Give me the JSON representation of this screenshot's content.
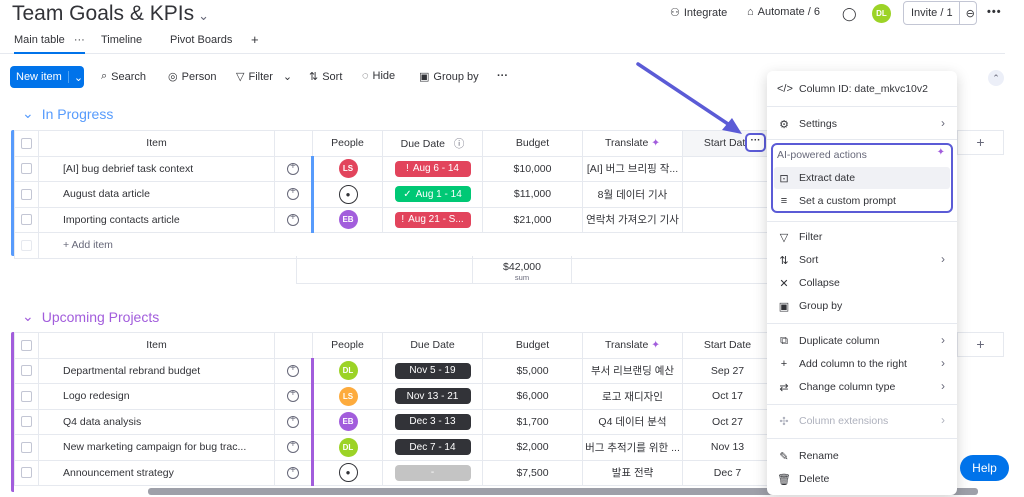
{
  "board": {
    "title": "Team Goals & KPIs"
  },
  "tabs": [
    "Main table",
    "Timeline",
    "Pivot Boards"
  ],
  "header": {
    "integrate": "Integrate",
    "automate": "Automate / 6",
    "user_initials": "DL",
    "invite": "Invite / 1"
  },
  "toolbar": {
    "new_item": "New item",
    "search": "Search",
    "person": "Person",
    "filter": "Filter",
    "sort": "Sort",
    "hide": "Hide",
    "group_by": "Group by"
  },
  "columns": {
    "item": "Item",
    "people": "People",
    "due_date": "Due Date",
    "budget": "Budget",
    "translate": "Translate",
    "start_date": "Start Date"
  },
  "groups": [
    {
      "title": "In Progress",
      "color": "#579bfc",
      "rows": [
        {
          "name": "[AI] bug debrief task context",
          "person": "LS",
          "person_color": "#e2445c",
          "due": "Aug 6 - 14",
          "due_color": "#e2445c",
          "due_icon": "!",
          "budget": "$10,000",
          "translate": "[AI] 버그 브리핑 작...",
          "start": ""
        },
        {
          "name": "August data article",
          "person": "",
          "person_color": "#323338",
          "due": "Aug 1 - 14",
          "due_color": "#00c875",
          "due_icon": "✓",
          "budget": "$11,000",
          "translate": "8월 데이터 기사",
          "start": ""
        },
        {
          "name": "Importing contacts article",
          "person": "EB",
          "person_color": "#a25ddc",
          "due": "Aug 21 - S...",
          "due_color": "#e2445c",
          "due_icon": "!",
          "budget": "$21,000",
          "translate": "연락처 가져오기 기사",
          "start": ""
        }
      ],
      "add_item": "+ Add item",
      "sum_value": "$42,000",
      "sum_label": "sum"
    },
    {
      "title": "Upcoming Projects",
      "color": "#a25ddc",
      "rows": [
        {
          "name": "Departmental rebrand budget",
          "person": "DL",
          "person_color": "#9cd326",
          "due": "Nov 5 - 19",
          "due_color": "#323338",
          "due_icon": "",
          "budget": "$5,000",
          "translate": "부서 리브랜딩 예산",
          "start": "Sep 27"
        },
        {
          "name": "Logo redesign",
          "person": "LS",
          "person_color": "#fdab3d",
          "due": "Nov 13 - 21",
          "due_color": "#323338",
          "due_icon": "",
          "budget": "$6,000",
          "translate": "로고 재디자인",
          "start": "Oct 17"
        },
        {
          "name": "Q4 data analysis",
          "person": "EB",
          "person_color": "#a25ddc",
          "due": "Dec 3 - 13",
          "due_color": "#323338",
          "due_icon": "",
          "budget": "$1,700",
          "translate": "Q4 데이터 분석",
          "start": "Oct 27"
        },
        {
          "name": "New marketing campaign for bug trac...",
          "person": "DL",
          "person_color": "#9cd326",
          "due": "Dec 7 - 14",
          "due_color": "#323338",
          "due_icon": "",
          "budget": "$2,000",
          "translate": "버그 추적기를 위한 ...",
          "start": "Nov 13"
        },
        {
          "name": "Announcement strategy",
          "person": "",
          "person_color": "#323338",
          "due": "-",
          "due_color": "#c4c4c4",
          "due_icon": "",
          "budget": "$7,500",
          "translate": "발표 전략",
          "start": "Dec 7"
        }
      ]
    }
  ],
  "menu": {
    "column_id": "Column ID: date_mkvc10v2",
    "settings": "Settings",
    "ai_header": "AI-powered actions",
    "extract_date": "Extract date",
    "custom_prompt": "Set a custom prompt",
    "filter": "Filter",
    "sort": "Sort",
    "collapse": "Collapse",
    "group_by": "Group by",
    "duplicate": "Duplicate column",
    "add_right": "Add column to the right",
    "change_type": "Change column type",
    "extensions": "Column extensions",
    "rename": "Rename",
    "delete": "Delete"
  },
  "help": "Help",
  "colors": {
    "accent": "#0073ea",
    "highlight": "#5b5bd6"
  }
}
